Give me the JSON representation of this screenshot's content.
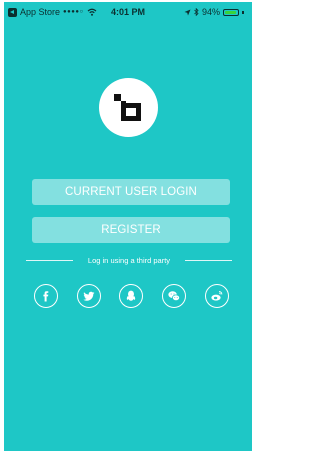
{
  "status_bar": {
    "carrier": "App Store",
    "signal": "●●●●○",
    "time": "4:01 PM",
    "battery_percent": "94%",
    "battery_level": 0.94
  },
  "buttons": {
    "login": "CURRENT USER LOGIN",
    "register": "REGISTER"
  },
  "third_party": {
    "label": "Log in using a third party",
    "providers": [
      "facebook-icon",
      "twitter-icon",
      "qq-icon",
      "wechat-icon",
      "weibo-icon"
    ]
  },
  "colors": {
    "background": "#1ec7c6",
    "logo_circle": "#ffffff",
    "logo_glyph": "#111111"
  }
}
